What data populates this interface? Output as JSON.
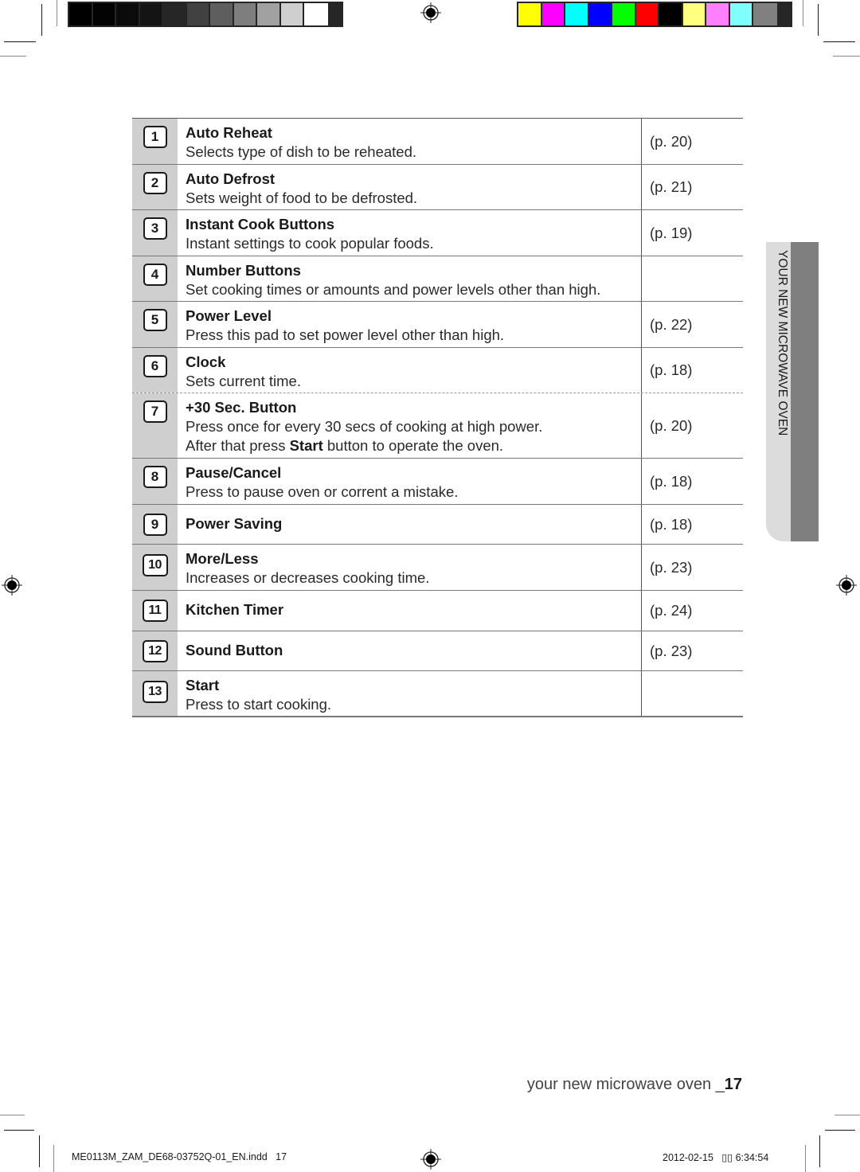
{
  "print_marks": {
    "grayscale_swatches": [
      "#000000",
      "#030303",
      "#0b0b0b",
      "#141414",
      "#262626",
      "#414141",
      "#5e5e5e",
      "#7e7e7e",
      "#a1a1a1",
      "#cfcfcf",
      "#ffffff"
    ],
    "color_swatches": [
      "#ffff00",
      "#ff00ff",
      "#00ffff",
      "#0000ff",
      "#00ff00",
      "#ff0000",
      "#000000",
      "#ffff80",
      "#ff80ff",
      "#80ffff",
      "#808080"
    ]
  },
  "side_tab": {
    "label": "YOUR NEW MICROWAVE OVEN"
  },
  "control_table": {
    "rows": [
      {
        "number": "1",
        "title": "Auto Reheat",
        "lines": [
          "Selects type of dish to be reheated."
        ],
        "page": "(p. 20)"
      },
      {
        "number": "2",
        "title": "Auto Defrost",
        "lines": [
          "Sets weight of food to be defrosted."
        ],
        "page": "(p. 21)"
      },
      {
        "number": "3",
        "title": "Instant Cook Buttons",
        "lines": [
          "Instant settings to cook popular foods."
        ],
        "page": "(p. 19)"
      },
      {
        "number": "4",
        "title": "Number Buttons",
        "lines": [
          "Set cooking times or amounts and power levels other than high."
        ],
        "page": ""
      },
      {
        "number": "5",
        "title": "Power Level",
        "lines": [
          "Press this pad to set power level other than high."
        ],
        "page": "(p. 22)"
      },
      {
        "number": "6",
        "title": "Clock",
        "lines": [
          "Sets current time."
        ],
        "page": "(p. 18)"
      },
      {
        "number": "7",
        "title": "+30 Sec. Button",
        "lines": [
          "Press once for every 30 secs of cooking at high power."
        ],
        "line2_pre": "After that press ",
        "line2_bold": "Start",
        "line2_post": " button to operate the oven.",
        "page": "(p. 20)"
      },
      {
        "number": "8",
        "title": "Pause/Cancel",
        "lines": [
          "Press to pause oven or corrent a mistake."
        ],
        "page": "(p. 18)"
      },
      {
        "number": "9",
        "title": "Power Saving",
        "lines": [],
        "page": "(p. 18)"
      },
      {
        "number": "10",
        "title": "More/Less",
        "lines": [
          "Increases or decreases cooking time."
        ],
        "page": "(p. 23)"
      },
      {
        "number": "11",
        "title": "Kitchen Timer",
        "lines": [],
        "page": "(p. 24)"
      },
      {
        "number": "12",
        "title": "Sound Button",
        "lines": [],
        "page": "(p. 23)"
      },
      {
        "number": "13",
        "title": "Start",
        "lines": [
          "Press to start cooking."
        ],
        "page": ""
      }
    ]
  },
  "footer": {
    "section_label": "your new microwave oven _",
    "page_number": "17",
    "file_slug": "ME0113M_ZAM_DE68-03752Q-01_EN.indd   17",
    "timestamp": "2012-02-15   ▯▯ 6:34:54"
  }
}
